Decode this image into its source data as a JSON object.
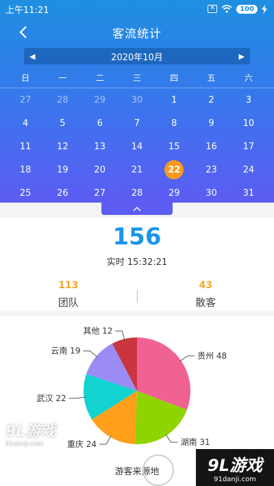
{
  "status": {
    "time": "上午11:21",
    "battery": "100"
  },
  "nav": {
    "title": "客流统计"
  },
  "calendar": {
    "month": "2020年10月",
    "weekdays": [
      "日",
      "一",
      "二",
      "三",
      "四",
      "五",
      "六"
    ],
    "rows": [
      [
        {
          "d": "27",
          "muted": true
        },
        {
          "d": "28",
          "muted": true
        },
        {
          "d": "29",
          "muted": true
        },
        {
          "d": "30",
          "muted": true
        },
        {
          "d": "1"
        },
        {
          "d": "2"
        },
        {
          "d": "3"
        }
      ],
      [
        {
          "d": "4"
        },
        {
          "d": "5"
        },
        {
          "d": "6"
        },
        {
          "d": "7"
        },
        {
          "d": "8"
        },
        {
          "d": "9"
        },
        {
          "d": "10"
        }
      ],
      [
        {
          "d": "11"
        },
        {
          "d": "12"
        },
        {
          "d": "13"
        },
        {
          "d": "14"
        },
        {
          "d": "15"
        },
        {
          "d": "16"
        },
        {
          "d": "17"
        }
      ],
      [
        {
          "d": "18"
        },
        {
          "d": "19"
        },
        {
          "d": "20"
        },
        {
          "d": "21"
        },
        {
          "d": "22",
          "selected": true
        },
        {
          "d": "23"
        },
        {
          "d": "24"
        }
      ],
      [
        {
          "d": "25"
        },
        {
          "d": "26"
        },
        {
          "d": "27"
        },
        {
          "d": "28"
        },
        {
          "d": "29"
        },
        {
          "d": "30"
        },
        {
          "d": "31"
        }
      ]
    ]
  },
  "stats": {
    "total": "156",
    "realtime_label": "实时 15:32:21",
    "team_count": "113",
    "team_label": "团队",
    "individual_count": "43",
    "individual_label": "散客"
  },
  "chart_label": "游客来源地",
  "chart_data": {
    "type": "pie",
    "slices": [
      {
        "name": "贵州",
        "value": 48,
        "color": "#f06292"
      },
      {
        "name": "湖南",
        "value": 31,
        "color": "#8fd400"
      },
      {
        "name": "重庆",
        "value": 24,
        "color": "#ff9f1a"
      },
      {
        "name": "武汉",
        "value": 22,
        "color": "#13d3d0"
      },
      {
        "name": "云南",
        "value": 19,
        "color": "#9b8cf5"
      },
      {
        "name": "其他",
        "value": 12,
        "color": "#c9353f"
      }
    ]
  },
  "watermark": {
    "logo": "9L游戏",
    "url": "91danji.com"
  },
  "colors": {
    "accent": "#1a95ec",
    "header_top": "#1f8fe0",
    "header_bottom": "#5c5cf3",
    "selected_day": "#f89a1c",
    "count": "#f5a623"
  }
}
